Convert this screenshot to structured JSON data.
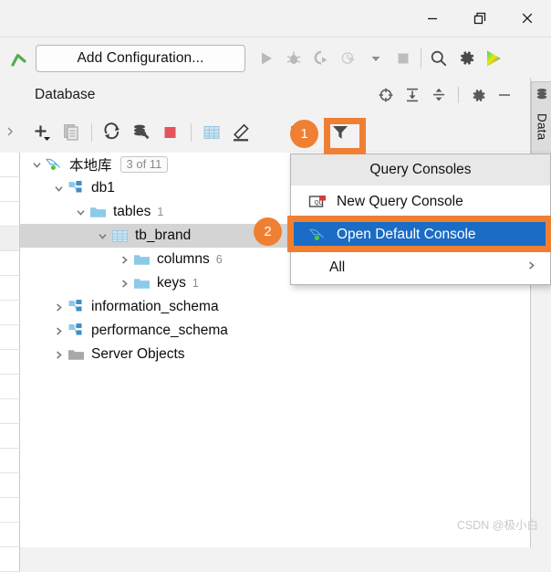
{
  "window": {
    "controls": [
      {
        "name": "minimize-button",
        "glyph": "minimize"
      },
      {
        "name": "restore-button",
        "glyph": "restore"
      },
      {
        "name": "close-button",
        "glyph": "close"
      }
    ]
  },
  "toolbar": {
    "back_icon": "back-arrow-icon",
    "add_configuration_label": "Add Configuration...",
    "icons": [
      {
        "name": "run-icon",
        "label": "Run"
      },
      {
        "name": "debug-icon",
        "label": "Debug"
      },
      {
        "name": "run-with-coverage-icon",
        "label": "Run with Coverage"
      },
      {
        "name": "profile-icon",
        "label": "Profile"
      },
      {
        "name": "dropdown-caret-icon",
        "label": "More"
      },
      {
        "name": "stop-icon",
        "label": "Stop"
      },
      {
        "name": "search-icon",
        "label": "Search Everywhere"
      },
      {
        "name": "settings-gear-icon",
        "label": "Settings"
      },
      {
        "name": "datagrip-logo-icon",
        "label": "DataGrip"
      }
    ]
  },
  "database_panel": {
    "title": "Database",
    "header_icons": [
      {
        "name": "scroll-from-source-icon",
        "label": "Scroll from Source"
      },
      {
        "name": "expand-all-icon",
        "label": "Expand All"
      },
      {
        "name": "collapse-all-icon",
        "label": "Collapse All"
      },
      {
        "name": "settings-gear-icon",
        "label": "Settings"
      },
      {
        "name": "hide-icon",
        "label": "Hide"
      }
    ],
    "toolbar_icons": [
      {
        "name": "add-new-icon",
        "label": "New"
      },
      {
        "name": "duplicate-icon",
        "label": "Duplicate"
      },
      {
        "name": "refresh-icon",
        "label": "Refresh"
      },
      {
        "name": "data-source-properties-icon",
        "label": "Data Source Properties"
      },
      {
        "name": "stop-refresh-icon",
        "label": "Stop"
      },
      {
        "name": "open-table-editor-icon",
        "label": "Table Editor"
      },
      {
        "name": "modify-icon",
        "label": "Modify"
      },
      {
        "name": "query-console-icon",
        "label": "QL"
      },
      {
        "name": "filter-icon",
        "label": "Filter"
      }
    ]
  },
  "tree": {
    "nodes": [
      {
        "name": "tree-node-local-db",
        "indent": 0,
        "chevron": "down",
        "icon": "mysql-dolphin-icon",
        "label": "本地库",
        "badge": "3 of 11",
        "count": "",
        "selected": false
      },
      {
        "name": "tree-node-db1",
        "indent": 1,
        "chevron": "down",
        "icon": "schema-icon",
        "label": "db1",
        "badge": "",
        "count": "",
        "selected": false
      },
      {
        "name": "tree-node-tables",
        "indent": 2,
        "chevron": "down",
        "icon": "folder-blue-icon",
        "label": "tables",
        "badge": "",
        "count": "1",
        "selected": false
      },
      {
        "name": "tree-node-tb-brand",
        "indent": 3,
        "chevron": "down",
        "icon": "table-icon",
        "label": "tb_brand",
        "badge": "",
        "count": "",
        "selected": true
      },
      {
        "name": "tree-node-columns",
        "indent": 4,
        "chevron": "right",
        "icon": "folder-blue-icon",
        "label": "columns",
        "badge": "",
        "count": "6",
        "selected": false
      },
      {
        "name": "tree-node-keys",
        "indent": 4,
        "chevron": "right",
        "icon": "folder-blue-icon",
        "label": "keys",
        "badge": "",
        "count": "1",
        "selected": false
      },
      {
        "name": "tree-node-information-schema",
        "indent": 1,
        "chevron": "right",
        "icon": "schema-icon",
        "label": "information_schema",
        "badge": "",
        "count": "",
        "selected": false
      },
      {
        "name": "tree-node-performance-schema",
        "indent": 1,
        "chevron": "right",
        "icon": "schema-icon",
        "label": "performance_schema",
        "badge": "",
        "count": "",
        "selected": false
      },
      {
        "name": "tree-node-server-objects",
        "indent": 1,
        "chevron": "right",
        "icon": "folder-grey-icon",
        "label": "Server Objects",
        "badge": "",
        "count": "",
        "selected": false
      }
    ]
  },
  "popup_menu": {
    "title": "Query Consoles",
    "items": [
      {
        "name": "menu-item-new-query-console",
        "label": "New Query Console",
        "icon": "new-query-console-icon",
        "active": false,
        "submenu": false
      },
      {
        "name": "menu-item-open-default-console",
        "label": "Open Default Console",
        "icon": "mysql-dolphin-icon",
        "active": true,
        "submenu": false
      },
      {
        "name": "menu-item-all",
        "label": "All",
        "icon": "",
        "active": false,
        "submenu": true
      }
    ]
  },
  "right_sidebar": {
    "tab_label": "Data",
    "tab_icon": "database-icon"
  },
  "annotations": {
    "accent_color": "#ef8033",
    "selection_color": "#1a6cc4",
    "steps": [
      {
        "name": "annotation-step-1",
        "number": "1"
      },
      {
        "name": "annotation-step-2",
        "number": "2"
      }
    ]
  },
  "watermark": {
    "text": "CSDN @极小白"
  }
}
